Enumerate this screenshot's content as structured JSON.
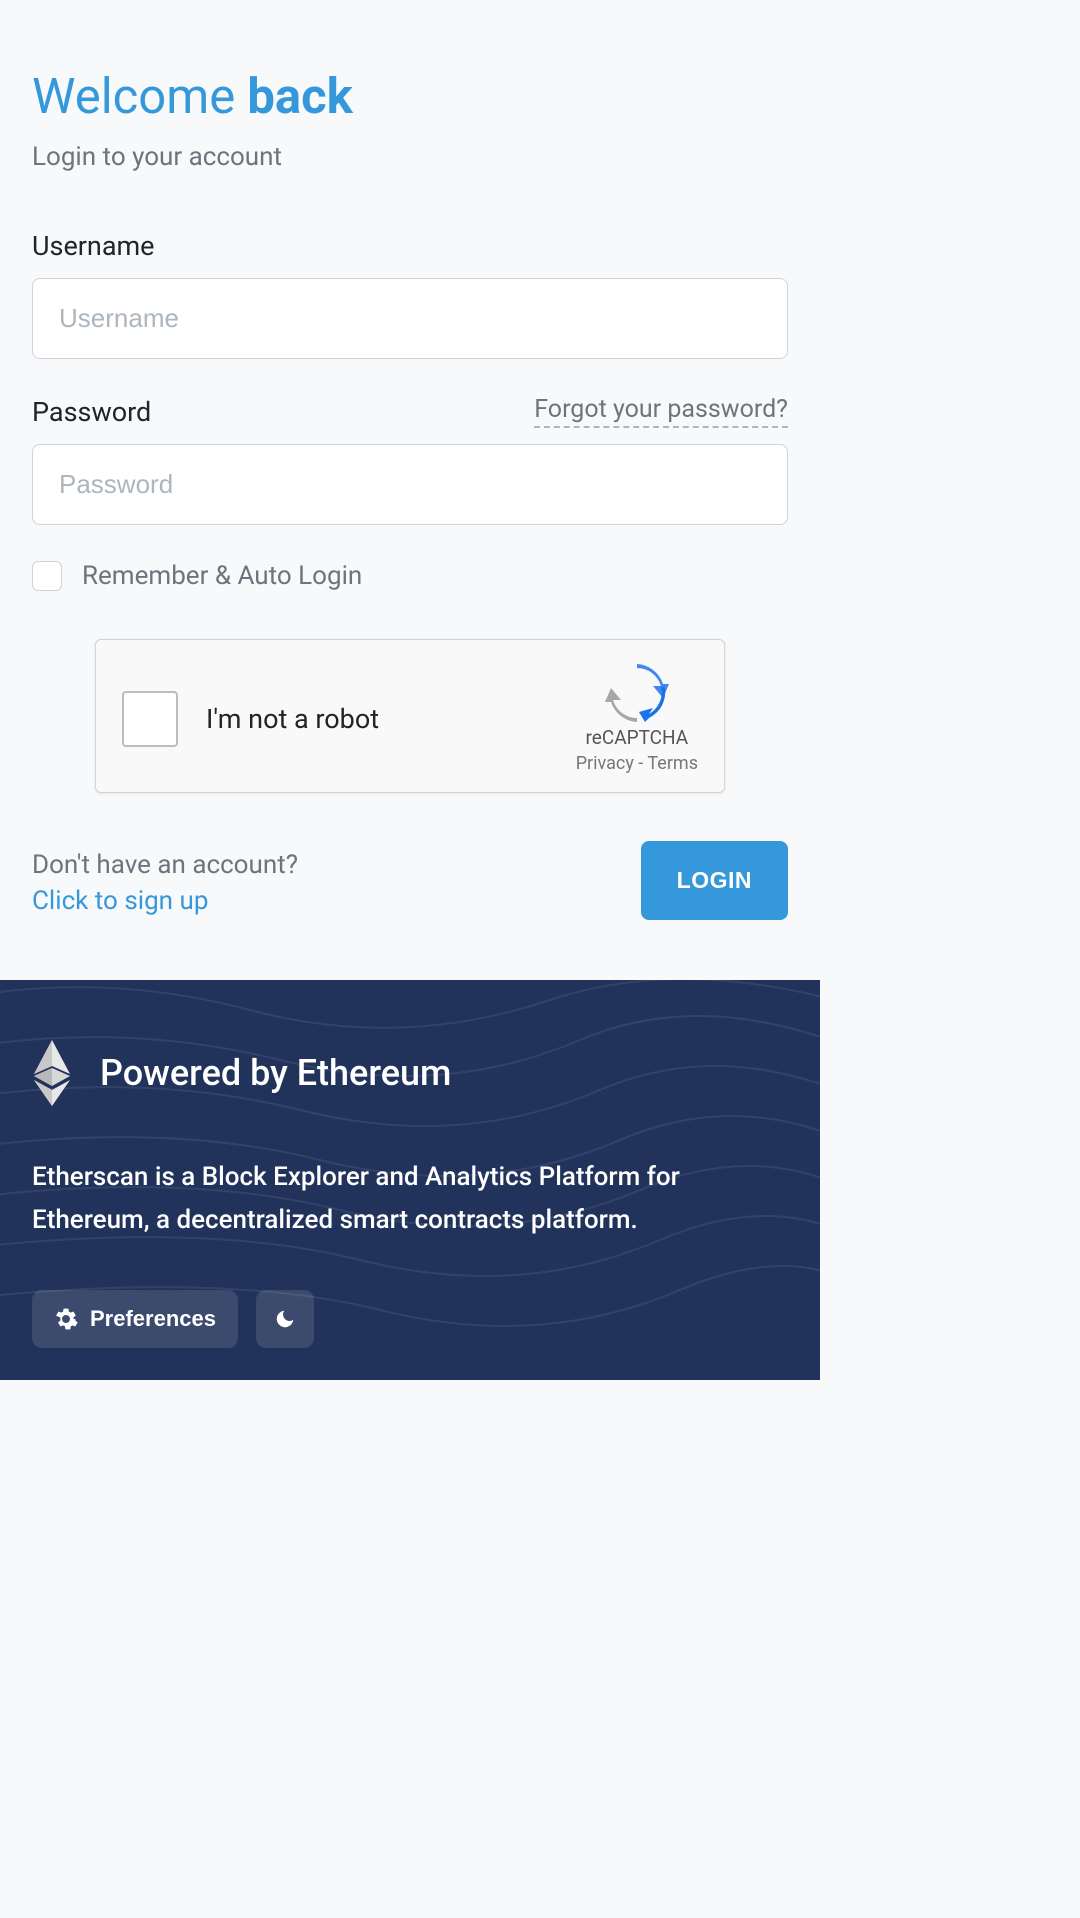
{
  "header": {
    "title_part1": "Welcome ",
    "title_part2": "back",
    "subtitle": "Login to your account"
  },
  "form": {
    "username_label": "Username",
    "username_placeholder": "Username",
    "password_label": "Password",
    "password_placeholder": "Password",
    "forgot_password": "Forgot your password?",
    "remember_label": "Remember & Auto Login"
  },
  "recaptcha": {
    "text": "I'm not a robot",
    "brand": "reCAPTCHA",
    "privacy": "Privacy",
    "separator": " - ",
    "terms": "Terms"
  },
  "signup": {
    "prompt": "Don't have an account?",
    "link": "Click to sign up"
  },
  "login_button": "LOGIN",
  "footer": {
    "title": "Powered by Ethereum",
    "description": "Etherscan is a Block Explorer and Analytics Platform for Ethereum, a decentralized smart contracts platform.",
    "preferences": "Preferences"
  },
  "colors": {
    "accent": "#3498db",
    "footer_bg": "#21325b"
  }
}
